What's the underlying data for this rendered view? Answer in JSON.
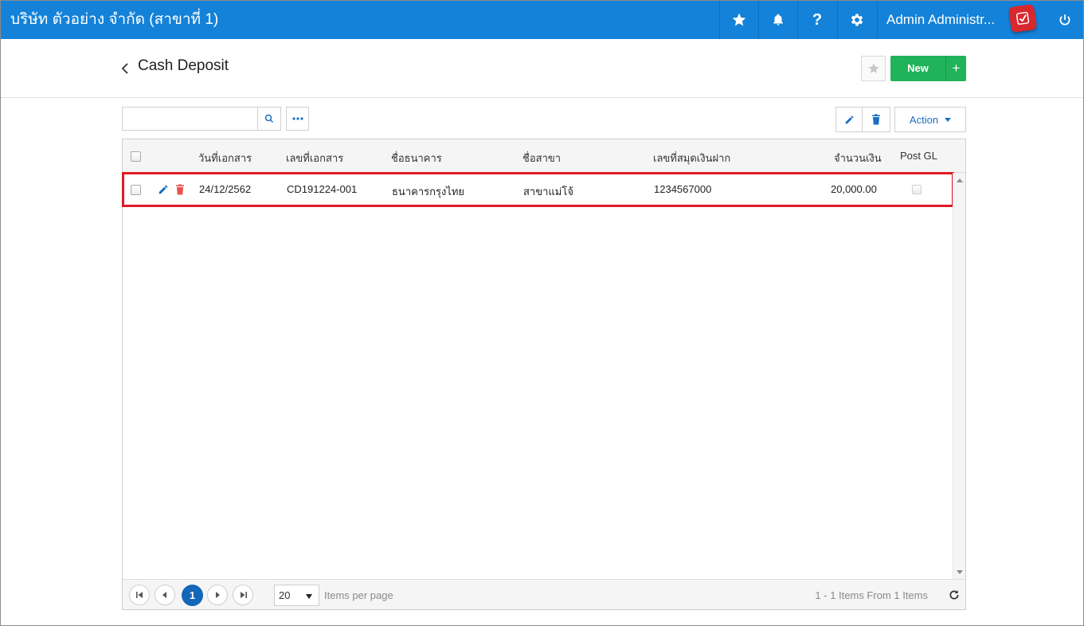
{
  "topbar": {
    "company": "บริษัท ตัวอย่าง จำกัด (สาขาที่ 1)",
    "favorites_icon": "star-icon",
    "notifications_icon": "bell-icon",
    "help_label": "?",
    "settings_icon": "gear-icon",
    "user_name": "Admin Administr...",
    "power_icon": "power-icon",
    "brand_color": "#1482d8"
  },
  "header": {
    "title": "Cash Deposit",
    "new_label": "New",
    "new_plus": "+"
  },
  "toolbar": {
    "search_value": "",
    "search_placeholder": "",
    "action_label": "Action"
  },
  "grid": {
    "columns": [
      "วันที่เอกสาร",
      "เลขที่เอกสาร",
      "ชื่อธนาคาร",
      "ชื่อสาขา",
      "เลขที่สมุดเงินฝาก",
      "จำนวนเงิน",
      "Post GL"
    ],
    "rows": [
      {
        "date": "24/12/2562",
        "doc_no": "CD191224-001",
        "bank": "ธนาคารกรุงไทย",
        "branch": "สาขาแม่โจ้",
        "account_no": "1234567000",
        "amount": "20,000.00",
        "post_gl": false
      }
    ]
  },
  "pager": {
    "current_page": "1",
    "page_size": "20",
    "items_per_page_label": "Items per page",
    "info": "1 - 1 Items From 1 Items"
  }
}
